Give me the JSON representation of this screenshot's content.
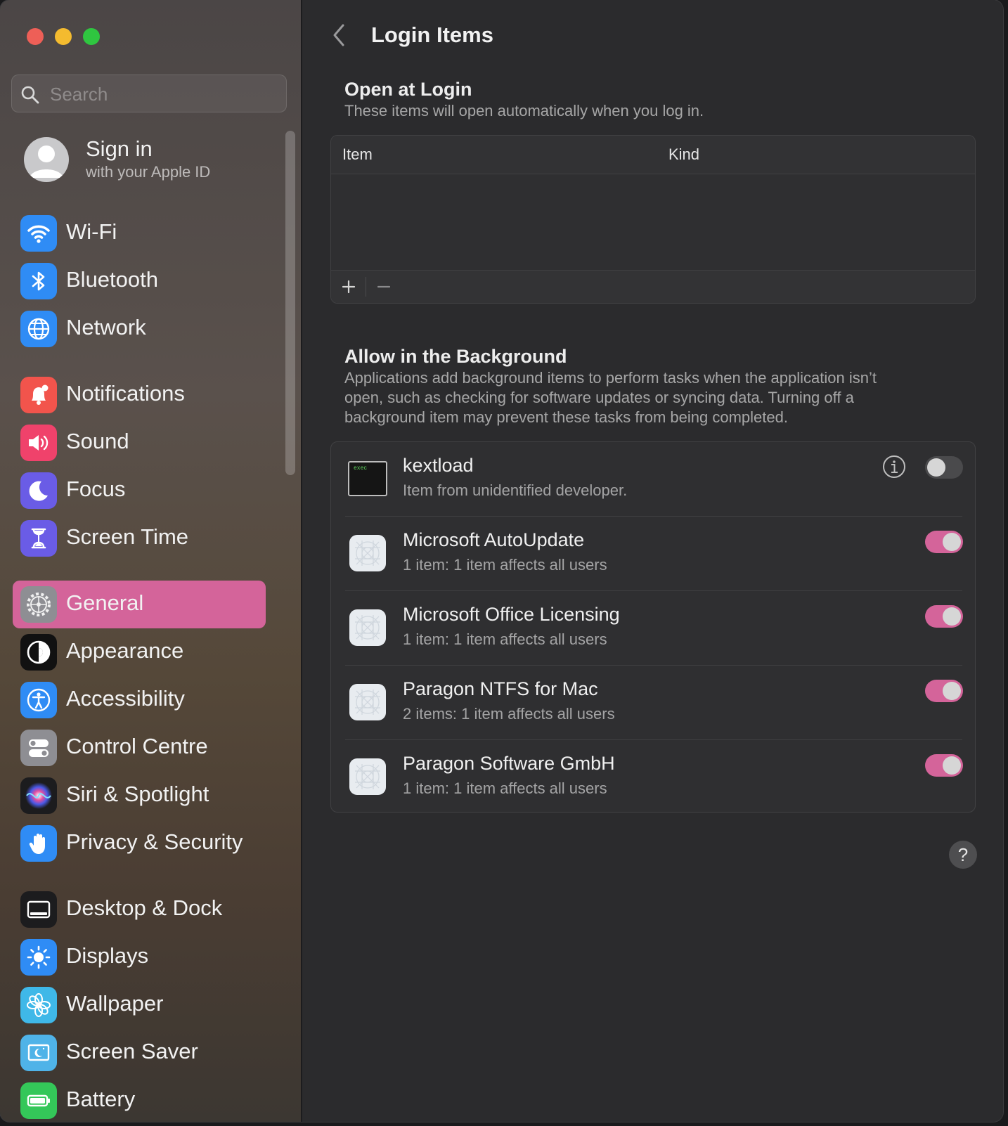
{
  "sidebar": {
    "search_placeholder": "Search",
    "account": {
      "title": "Sign in",
      "subtitle": "with your Apple ID"
    },
    "items": [
      {
        "label": "Wi-Fi",
        "icon": "wifi-icon",
        "color": "#2f8cf5"
      },
      {
        "label": "Bluetooth",
        "icon": "bluetooth-icon",
        "color": "#2f8cf5"
      },
      {
        "label": "Network",
        "icon": "globe-icon",
        "color": "#2f8cf5"
      },
      {
        "label": "Notifications",
        "icon": "bell-icon",
        "color": "#f2544c"
      },
      {
        "label": "Sound",
        "icon": "speaker-icon",
        "color": "#f0426b"
      },
      {
        "label": "Focus",
        "icon": "moon-icon",
        "color": "#6a5ce6"
      },
      {
        "label": "Screen Time",
        "icon": "hourglass-icon",
        "color": "#6a5ce6"
      },
      {
        "label": "General",
        "icon": "gear-icon",
        "color": "#8e8e93",
        "active": true
      },
      {
        "label": "Appearance",
        "icon": "appearance-icon",
        "color": "#111111"
      },
      {
        "label": "Accessibility",
        "icon": "accessibility-icon",
        "color": "#2f8cf5"
      },
      {
        "label": "Control Centre",
        "icon": "control-centre-icon",
        "color": "#8e8e93"
      },
      {
        "label": "Siri & Spotlight",
        "icon": "siri-icon",
        "color": "#1c1c1e"
      },
      {
        "label": "Privacy & Security",
        "icon": "hand-icon",
        "color": "#2f8cf5"
      },
      {
        "label": "Desktop & Dock",
        "icon": "dock-icon",
        "color": "#1c1c1e"
      },
      {
        "label": "Displays",
        "icon": "sun-icon",
        "color": "#2f8cf5"
      },
      {
        "label": "Wallpaper",
        "icon": "flower-icon",
        "color": "#3fb8e8"
      },
      {
        "label": "Screen Saver",
        "icon": "screen-saver-icon",
        "color": "#4fb3e8"
      },
      {
        "label": "Battery",
        "icon": "battery-icon",
        "color": "#34c759"
      }
    ]
  },
  "main": {
    "title": "Login Items",
    "open_at_login": {
      "title": "Open at Login",
      "description": "These items will open automatically when you log in.",
      "columns": [
        "Item",
        "Kind"
      ],
      "add_label": "+",
      "remove_label": "−"
    },
    "background": {
      "title": "Allow in the Background",
      "description_lines": [
        "Applications add background items to perform tasks when the application isn’t",
        "open, such as checking for software updates or syncing data. Turning off a",
        "background item may prevent these tasks from being completed."
      ],
      "items": [
        {
          "name": "kextload",
          "subtitle": "Item from unidentified developer.",
          "enabled": false,
          "icon": "exec-terminal-icon",
          "icon_text": "exec",
          "has_info": true
        },
        {
          "name": "Microsoft AutoUpdate",
          "subtitle": "1 item: 1 item affects all users",
          "enabled": true,
          "icon": "app-placeholder-icon"
        },
        {
          "name": "Microsoft Office Licensing",
          "subtitle": "1 item: 1 item affects all users",
          "enabled": true,
          "icon": "app-placeholder-icon"
        },
        {
          "name": "Paragon NTFS for Mac",
          "subtitle": "2 items: 1 item affects all users",
          "enabled": true,
          "icon": "app-placeholder-icon"
        },
        {
          "name": "Paragon Software GmbH",
          "subtitle": "1 item: 1 item affects all users",
          "enabled": true,
          "icon": "app-placeholder-icon"
        }
      ]
    },
    "help_label": "?"
  },
  "colors": {
    "accent": "#d4649a",
    "window_bg": "#2b2b2d",
    "panel_bg": "#2f2f31"
  }
}
